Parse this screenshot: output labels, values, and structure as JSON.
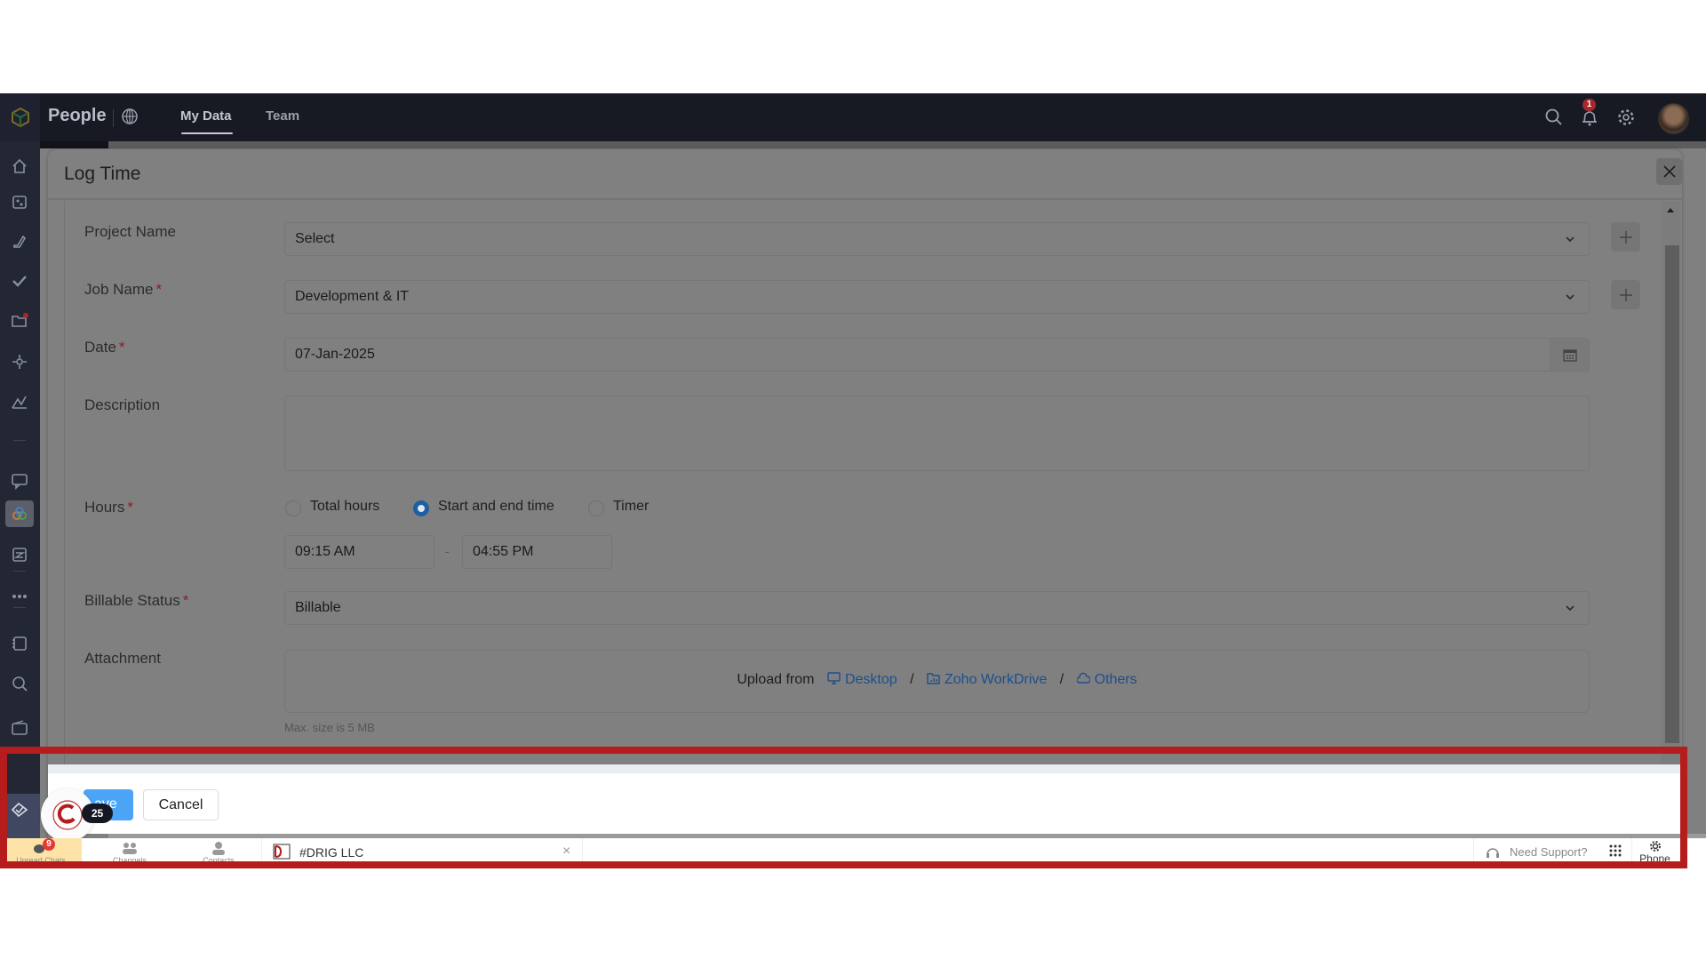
{
  "topbar": {
    "app_name": "People",
    "tabs": [
      {
        "label": "My Data",
        "active": true
      },
      {
        "label": "Team",
        "active": false
      }
    ],
    "notification_count": "1",
    "icons": [
      "search-icon",
      "bell-icon",
      "gear-icon",
      "avatar"
    ]
  },
  "sidebar": {
    "icons": [
      "home-icon",
      "leave-icon",
      "attendance-icon",
      "check-icon",
      "files-icon",
      "performance-icon",
      "analytics-icon",
      "chat-icon",
      "timetracker-icon",
      "forms-icon",
      "more-icon",
      "notes-icon",
      "search-people-icon",
      "wallet-icon",
      "approval-icon",
      "compensation-icon"
    ],
    "active": "timetracker-icon"
  },
  "modal": {
    "title": "Log Time",
    "fields": {
      "project": {
        "label": "Project Name",
        "value": "Select",
        "required": false
      },
      "job": {
        "label": "Job Name",
        "value": "Development & IT",
        "required": true
      },
      "date": {
        "label": "Date",
        "value": "07-Jan-2025",
        "required": true
      },
      "description": {
        "label": "Description",
        "value": ""
      },
      "hours": {
        "label": "Hours",
        "options": [
          "Total hours",
          "Start and end time",
          "Timer"
        ],
        "selected": "Start and end time",
        "start_time": "09:15 AM",
        "separator": "-",
        "end_time": "04:55 PM"
      },
      "billable": {
        "label": "Billable Status",
        "value": "Billable",
        "required": true
      },
      "attachment": {
        "label": "Attachment",
        "upload_prefix": "Upload from",
        "sources": [
          "Desktop",
          "Zoho WorkDrive",
          "Others"
        ],
        "separator": "/",
        "hint": "Max. size is 5 MB"
      }
    },
    "required_marker": "*",
    "footer": {
      "save_label": "Save",
      "save_visible_text": "ave",
      "cancel_label": "Cancel"
    }
  },
  "chat_widget": {
    "unread_count": "25"
  },
  "bottombar": {
    "tabs": [
      {
        "label": "Unread Chats",
        "badge": "9",
        "active": true
      },
      {
        "label": "Channels",
        "active": false
      },
      {
        "label": "Contacts",
        "active": false
      }
    ],
    "open_chat": "#DRIG LLC",
    "support_label": "Need Support?",
    "phone_label": "Phone"
  },
  "colors": {
    "accent_blue": "#4ba4f5",
    "radio_selected": "#1e5fa3",
    "link": "#1d4e8c",
    "required": "#8a1f24",
    "highlight": "#b71c1c",
    "topbar_bg": "#171a23"
  }
}
